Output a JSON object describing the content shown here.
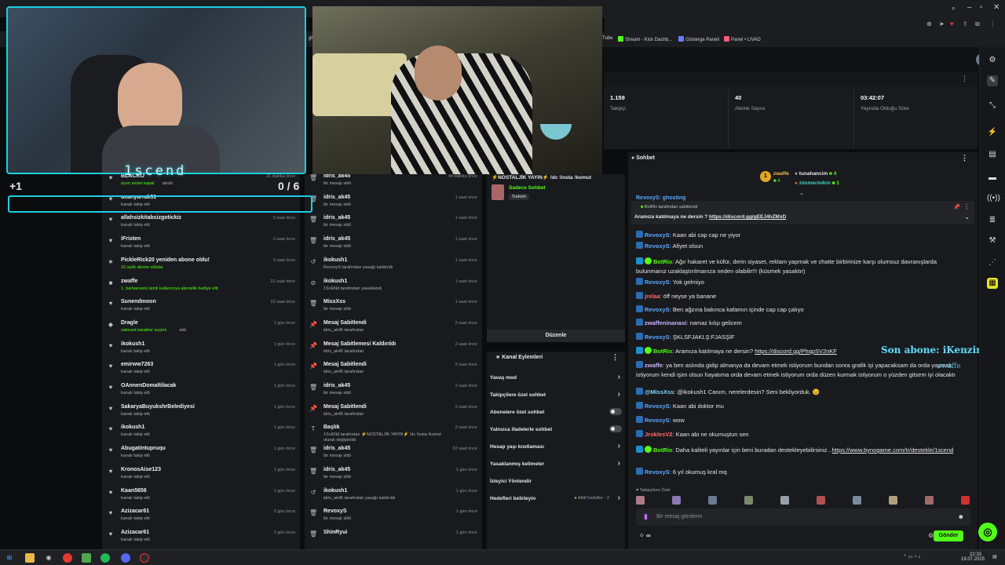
{
  "browser": {
    "bookmarks": [
      "Tube",
      "Stream - Kick Dashb...",
      "Gösterge Paneli",
      "Panel • LIVAD"
    ],
    "fragment": "ght"
  },
  "overlay": {
    "cam_name": "1scend",
    "plus_count": "+1",
    "goal_counter": "0 / 6",
    "last_sub": "Son abone: iKenzin",
    "sub_ghost": "zwaffe"
  },
  "activity_feed": [
    {
      "name": "BLACKO",
      "sub": "oyun sesini kapat",
      "sub2": "alındı",
      "time": "21 dakika önce",
      "icon": "♥"
    },
    {
      "name": "ucanyarrak31",
      "sub": "kanalı takip etti",
      "time": "",
      "icon": "♥"
    },
    {
      "name": "allahsizkitabsizgotickiz",
      "sub": "kanalı takip etti",
      "time": "2 saat önce",
      "icon": "♥"
    },
    {
      "name": "iFristen",
      "sub": "kanalı takip etti",
      "time": "2 saat önce",
      "icon": "♥"
    },
    {
      "name": "PickleRick20 yeniden abone oldu!",
      "sub": "10 aylık abone oldular",
      "time": "3 saat önce",
      "icon": "★"
    },
    {
      "name": "zwaffe",
      "sub": "1. barbarsami isimli kullanıcıya abonelik hediye etti.",
      "time": "22 saat önce",
      "icon": "■"
    },
    {
      "name": "Sunendmoon",
      "sub": "kanalı takip etti",
      "time": "23 saat önce",
      "icon": "♥"
    },
    {
      "name": "Dragle",
      "sub": "valorant karakter seçimi",
      "sub2": "aldı",
      "time": "1 gün önce",
      "icon": "◆"
    },
    {
      "name": "ikokush1",
      "sub": "kanalı takip etti",
      "time": "1 gün önce",
      "icon": "♥"
    },
    {
      "name": "emirww7263",
      "sub": "kanalı takip etti",
      "time": "1 gün önce",
      "icon": "♥"
    },
    {
      "name": "OAnnenDomaltilacak",
      "sub": "kanalı takip etti",
      "time": "1 gün önce",
      "icon": "♥"
    },
    {
      "name": "SakaryaBuyukshrBelediyesi",
      "sub": "kanalı takip etti",
      "time": "1 gün önce",
      "icon": "♥"
    },
    {
      "name": "ikokush1",
      "sub": "kanalı takip etti",
      "time": "1 gün önce",
      "icon": "♥"
    },
    {
      "name": "Abugatintupruqu",
      "sub": "kanalı takip etti",
      "time": "1 gün önce",
      "icon": "♥"
    },
    {
      "name": "KronosAise123",
      "sub": "kanalı takip etti",
      "time": "1 gün önce",
      "icon": "♥"
    },
    {
      "name": "Kaan5656",
      "sub": "kanalı takip etti",
      "time": "1 gün önce",
      "icon": "♥"
    },
    {
      "name": "Azizacar61",
      "sub": "kanalı takip etti",
      "time": "2 gün önce",
      "icon": "♥"
    },
    {
      "name": "Azizacar61",
      "sub": "kanalı takip etti",
      "time": "2 gün önce",
      "icon": "♥"
    }
  ],
  "mod_log": [
    {
      "name": "idris_ak45",
      "sub": "bir mesajı sildi",
      "time": "44 dakika önce",
      "icon": "🗑"
    },
    {
      "name": "idris_ak45",
      "sub": "bir mesajı sildi",
      "time": "1 saat önce",
      "icon": "🗑"
    },
    {
      "name": "idris_ak45",
      "sub": "bir mesajı sildi",
      "time": "1 saat önce",
      "icon": "🗑"
    },
    {
      "name": "idris_ak45",
      "sub": "bir mesajı sildi",
      "time": "1 saat önce",
      "icon": "🗑"
    },
    {
      "name": "ikokush1",
      "sub": "RevoxyS tarafından yasağı kaldırıldı",
      "time": "1 saat önce",
      "icon": "↺"
    },
    {
      "name": "ikokush1",
      "sub": "1ScENd tarafından yasaklandı",
      "time": "1 saat önce",
      "icon": "⊘"
    },
    {
      "name": "MissXss",
      "sub": "bir mesajı sildi",
      "time": "1 saat önce",
      "icon": "🗑"
    },
    {
      "name": "Mesaj Sabitlendi",
      "sub": "idris_ak45 tarafından",
      "time": "2 saat önce",
      "icon": "📌"
    },
    {
      "name": "Mesaj Sabitlemesi Kaldırıldı",
      "sub": "idris_ak45 tarafından",
      "time": "2 saat önce",
      "icon": "📌"
    },
    {
      "name": "Mesaj Sabitlendi",
      "sub": "idris_ak45 tarafından",
      "time": "2 saat önce",
      "icon": "📌"
    },
    {
      "name": "idris_ak45",
      "sub": "bir mesajı sildi",
      "time": "2 saat önce",
      "icon": "🗑"
    },
    {
      "name": "Mesaj Sabitlendi",
      "sub": "idris_ak45 tarafından",
      "time": "2 saat önce",
      "icon": "📌"
    },
    {
      "name": "Başlık",
      "sub": "1ScENd tarafından ⚡NOSTALJİK YAYIN⚡ !dc !insta !komut olarak değiştirildi",
      "time": "2 saat önce",
      "icon": "T"
    },
    {
      "name": "idris_ak45",
      "sub": "bir mesajı sildi",
      "time": "22 saat önce",
      "icon": "🗑"
    },
    {
      "name": "idris_ak45",
      "sub": "bir mesajı sildi",
      "time": "1 gün önce",
      "icon": "🗑"
    },
    {
      "name": "ikokush1",
      "sub": "idris_ak45 tarafından yasağı kaldırıldı",
      "time": "1 gün önce",
      "icon": "↺"
    },
    {
      "name": "RevoxyS",
      "sub": "bir mesajı sildi",
      "time": "1 gün önce",
      "icon": "🗑"
    },
    {
      "name": "ShinRyui",
      "sub": "",
      "time": "1 gün önce",
      "icon": "🗑"
    }
  ],
  "stream_info": {
    "title": "⚡NOSTALJİK YAYIN⚡ !dc !insta !komut",
    "category": "Sadece Sohbet",
    "language": "Turkish",
    "edit_label": "Düzenle"
  },
  "channel_actions": {
    "title": "Kanal Eylemleri",
    "items": [
      {
        "label": "Yavaş mod",
        "type": "arrow"
      },
      {
        "label": "Takipçilere özel sohbet",
        "type": "arrow"
      },
      {
        "label": "Abonelere özel sohbet",
        "type": "toggle"
      },
      {
        "label": "Yalnızca ifadelerle sohbet",
        "type": "toggle"
      },
      {
        "label": "Hesap yaşı kısıtlaması",
        "type": "arrow"
      },
      {
        "label": "Yasaklanmış kelimeler",
        "type": "arrow"
      },
      {
        "label": "İzleyici Yönlendir",
        "type": "none"
      },
      {
        "label": "Hedefleri belirleyin",
        "type": "arrow",
        "extra": "Aktif hedefler - 2"
      }
    ]
  },
  "stats": [
    {
      "value": "1.159",
      "label": "Takipçi"
    },
    {
      "value": "40",
      "label": "Abone Sayısı"
    },
    {
      "value": "03:42:07",
      "label": "Yayında Olduğu Süre"
    }
  ],
  "chat": {
    "title": "Sohbet",
    "leaders": [
      {
        "name": "zwaffe",
        "count": "4"
      },
      {
        "name": "tunahancim",
        "count": "4"
      },
      {
        "name": "zimmerm4nn",
        "count": "1"
      }
    ],
    "pinned_by": "BotRix tarafından sabitlendi",
    "pinned_text": "Aramıza katılmaya ne dersin ?",
    "pinned_link": "https://discord.gg/gEEJ4hZMxD",
    "top_fragment": "RevoxyS: ghosting",
    "messages": [
      {
        "user": "RevoxyS",
        "text": "Kaan abi cap cap ne yiyor",
        "color": "#5aa9ff"
      },
      {
        "user": "RevoxyS",
        "text": "Afiyet olsun",
        "color": "#5aa9ff"
      },
      {
        "user": "BotRix",
        "text": "Ağır hakaret ve küfür, derin siyaset, reklam yapmak ve chatte birbirinize karşı olumsuz davranışlarda bulunmanız uzaklaştırılmanıza neden olabilir!!! (küsmek yasaktır)",
        "color": "#53fc18"
      },
      {
        "user": "RevoxyS",
        "text": "Yok gelmiyo",
        "color": "#5aa9ff"
      },
      {
        "user": "jrelaa",
        "text": "öff neyse ya banane",
        "color": "#ff6b6b"
      },
      {
        "user": "RevoxyS",
        "text": "Ben ağzına bakınca kafamın içinde cap cap çalıyo",
        "color": "#5aa9ff"
      },
      {
        "user": "zwaffeninanasi",
        "text": "namaz kılıp gelicem",
        "color": "#c9b3ff"
      },
      {
        "user": "RevoxyS",
        "text": "ŞKLSFJAKLŞ:FJASŞİF",
        "color": "#5aa9ff"
      },
      {
        "user": "BotRix",
        "text": "Aramıza katılmaya ne dersin? ",
        "link": "https://discord.gg/PhqpSV2nKF",
        "color": "#53fc18"
      },
      {
        "user": "zwaffe",
        "text": "ya ben aslında gidip almanya da devam etmek istiyorum bundan sonra grafik işi yapacaksam da orda yapmak istiyorum kendi işim olsun hayatıma orda devam etmek istiyorum orda düzen kurmak istiyorum o yüzden gitsem iyi olacaktı",
        "color": "#c9b3ff"
      },
      {
        "user": "@MissXss",
        "text": "@ikokush1 Canım, nerelerdesin? Seni bekliyorduk. 😉",
        "color": "#7fd4ff"
      },
      {
        "user": "RevoxyS",
        "text": "Kaan abi doktor mu",
        "color": "#5aa9ff"
      },
      {
        "user": "RevoxyS",
        "text": "wow",
        "color": "#5aa9ff"
      },
      {
        "user": "JroklesV2",
        "text": "Kaan abi ne okumuştun sen",
        "color": "#ff6b6b"
      },
      {
        "user": "BotRix",
        "text": "Daha kaliteli yayınlar için beni buradan destekleyebilirsiniz...",
        "link": "https://www.bynogame.com/tr/destekle/1scend",
        "color": "#53fc18"
      },
      {
        "user": "RevoxyS",
        "text": "6 yıl okumuş kral mq",
        "color": "#5aa9ff"
      }
    ],
    "follower_only_label": "Takipçilere Özel",
    "input_placeholder": "Bir mesaj gönderin",
    "send_label": "Gönder",
    "points": "∞"
  },
  "taskbar": {
    "time": "22:33",
    "date": "19.07.2025"
  }
}
